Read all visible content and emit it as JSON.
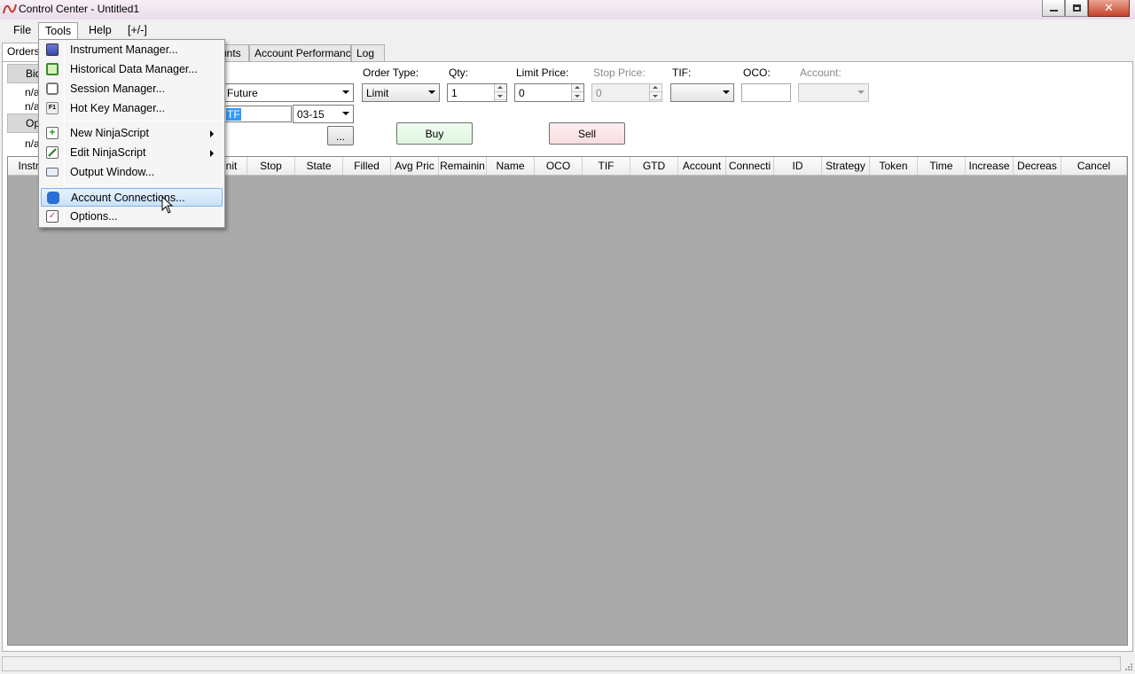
{
  "window": {
    "title": "Control Center - Untitled1"
  },
  "menubar": {
    "items": [
      "File",
      "Tools",
      "Help",
      "[+/-]"
    ]
  },
  "tabs": [
    "Orders",
    "unts",
    "Account Performance",
    "Log"
  ],
  "left_grid": {
    "header1": "Bid",
    "row1": "n/a",
    "row2": "n/a",
    "header2": "Ope",
    "row3": "n/a"
  },
  "order_entry": {
    "instrument_type": "Future",
    "symbol_value": "TF",
    "expiry": "03-15",
    "order_type_label": "Order Type:",
    "order_type": "Limit",
    "qty_label": "Qty:",
    "qty": "1",
    "limit_price_label": "Limit Price:",
    "limit_price": "0",
    "stop_price_label": "Stop Price:",
    "stop_price": "0",
    "tif_label": "TIF:",
    "tif": "",
    "oco_label": "OCO:",
    "oco": "",
    "account_label": "Account:",
    "account": "",
    "ellipsis": "...",
    "buy": "Buy",
    "sell": "Sell"
  },
  "orders_grid": {
    "columns": [
      "Instru",
      "nit",
      "Stop",
      "State",
      "Filled",
      "Avg Pric",
      "Remainin",
      "Name",
      "OCO",
      "TIF",
      "GTD",
      "Account",
      "Connecti",
      "ID",
      "Strategy",
      "Token",
      "Time",
      "Increase",
      "Decreas",
      "Cancel"
    ]
  },
  "tools_menu": {
    "items": [
      {
        "label": "Instrument Manager...",
        "icon": "instrument-manager-icon"
      },
      {
        "label": "Historical Data Manager...",
        "icon": "historical-data-icon"
      },
      {
        "label": "Session Manager...",
        "icon": "session-manager-icon"
      },
      {
        "label": "Hot Key Manager...",
        "icon": "hot-key-icon"
      },
      {
        "label": "New NinjaScript",
        "icon": "new-script-icon"
      },
      {
        "label": "Edit NinjaScript",
        "icon": "edit-script-icon"
      },
      {
        "label": "Output Window...",
        "icon": "output-window-icon"
      },
      {
        "label": "Account Connections...",
        "icon": "account-connections-icon"
      },
      {
        "label": "Options...",
        "icon": "options-icon"
      }
    ],
    "hot_key_icon_text": "F1"
  },
  "colors": {
    "accent_highlight": "#c9e1f8",
    "buy_bg": "#dff5df",
    "sell_bg": "#f8dde0",
    "grid_bg": "#aaaaaa"
  }
}
